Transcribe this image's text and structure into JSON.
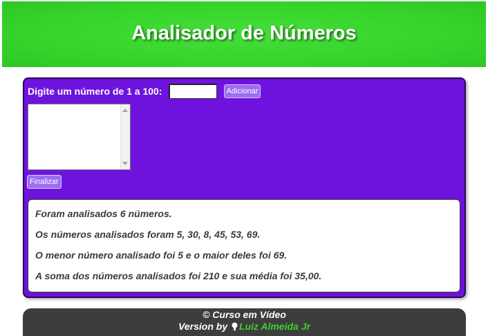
{
  "header": {
    "title": "Analisador de Números"
  },
  "form": {
    "prompt_label": "Digite um número de 1 a 100:",
    "number_input": {
      "value": "",
      "placeholder": ""
    },
    "add_button": "Adicionar",
    "finish_button": "Finalizar"
  },
  "results": {
    "lines": [
      "Foram analisados 6 números.",
      "Os números analisados foram 5, 30, 8, 45, 53, 69.",
      "O menor número analisado foi 5 e o maior deles foi 69.",
      "A soma dos números analisados foi 210 e sua média foi 35,00."
    ]
  },
  "footer": {
    "copyright": "© Curso em Vídeo",
    "version_prefix": "Version by",
    "author": "Luiz Almeida Jr",
    "author_icon": "github-icon"
  },
  "colors": {
    "header_bg": "#36d52b",
    "panel_bg": "#6e13de",
    "button_bg": "#9b6ef0",
    "footer_bg": "#3d3d3d",
    "author_link": "#3ad130"
  }
}
